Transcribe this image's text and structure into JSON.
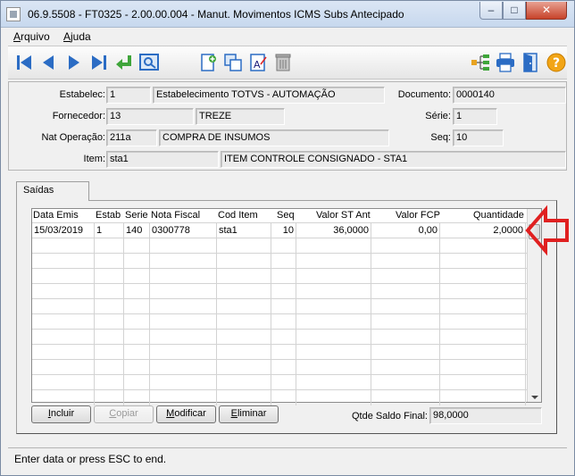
{
  "window": {
    "title": "06.9.5508 - FT0325 - 2.00.00.004 - Manut. Movimentos ICMS Subs Antecipado",
    "min_glyph": "–",
    "max_glyph": "□",
    "close_glyph": "✕"
  },
  "menu": {
    "arquivo_first": "A",
    "arquivo_rest": "rquivo",
    "ajuda_first": "A",
    "ajuda_rest": "juda"
  },
  "toolbar_icons": [
    "first-record-icon",
    "previous-record-icon",
    "next-record-icon",
    "last-record-icon",
    "goto-icon",
    "search-icon",
    "new-document-icon",
    "copy-icon",
    "edit-text-icon",
    "delete-trash-icon",
    "tree-structure-icon",
    "printer-icon",
    "exit-door-icon",
    "help-icon"
  ],
  "form": {
    "estabelec_label": "Estabelec:",
    "estabelec_code": "1",
    "estabelec_name": "Estabelecimento TOTVS - AUTOMAÇÃO",
    "documento_label": "Documento:",
    "documento_value": "0000140",
    "fornecedor_label": "Fornecedor:",
    "fornecedor_code": "13",
    "fornecedor_name": "TREZE",
    "serie_label": "Série:",
    "serie_value": "1",
    "nat_label": "Nat Operação:",
    "nat_code": "211a",
    "nat_name": "COMPRA DE INSUMOS",
    "seq_label": "Seq:",
    "seq_value": "10",
    "item_label": "Item:",
    "item_code": "sta1",
    "item_name": "ITEM CONTROLE CONSIGNADO - STA1"
  },
  "tabs": {
    "saidas": "Saídas"
  },
  "grid": {
    "columns": {
      "data_emis": "Data Emis",
      "estab": "Estab",
      "serie": "Serie",
      "nota_fiscal": "Nota Fiscal",
      "cod_item": "Cod Item",
      "seq": "Seq",
      "valor_st_ant": "Valor ST Ant",
      "valor_fcp": "Valor FCP",
      "quantidade": "Quantidade"
    },
    "rows": [
      {
        "data_emis": "15/03/2019",
        "estab": "1",
        "serie": "140",
        "nota_fiscal": "0300778",
        "cod_item": "sta1",
        "seq": "10",
        "valor_st_ant": "36,0000",
        "valor_fcp": "0,00",
        "quantidade": "2,0000"
      }
    ]
  },
  "buttons": {
    "incluir_first": "I",
    "incluir_rest": "ncluir",
    "copiar_first": "C",
    "copiar_rest": "opiar",
    "modificar_first": "M",
    "modificar_rest": "odificar",
    "eliminar_first": "E",
    "eliminar_rest": "liminar"
  },
  "saldo": {
    "label": "Qtde Saldo Final:",
    "value": "98,0000"
  },
  "status": {
    "text": "Enter data or press ESC to end."
  },
  "colors": {
    "accent_red": "#e02020",
    "toolbar_blue": "#2b6cc4",
    "arrow_green": "#3fa53a"
  }
}
